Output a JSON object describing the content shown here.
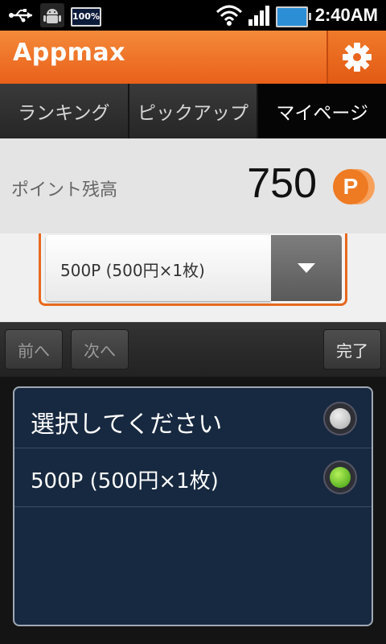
{
  "status_bar": {
    "battery_small_label": "100%",
    "time": "2:40AM"
  },
  "header": {
    "app_name": "Appmax"
  },
  "tabs": [
    {
      "label": "ランキング"
    },
    {
      "label": "ピックアップ"
    },
    {
      "label": "マイページ"
    }
  ],
  "points": {
    "label": "ポイント残高",
    "value": "750",
    "badge_letter": "P"
  },
  "select": {
    "selected_value": "500P (500円×1枚)"
  },
  "keyboard_toolbar": {
    "prev_label": "前へ",
    "next_label": "次へ",
    "done_label": "完了"
  },
  "picker": {
    "options": [
      {
        "label": "選択してください",
        "selected": false
      },
      {
        "label": "500P (500円×1枚)",
        "selected": true
      }
    ]
  },
  "colors": {
    "brand_orange": "#e9601a",
    "picker_bg": "#172940",
    "radio_selected": "#3a9c0f"
  }
}
